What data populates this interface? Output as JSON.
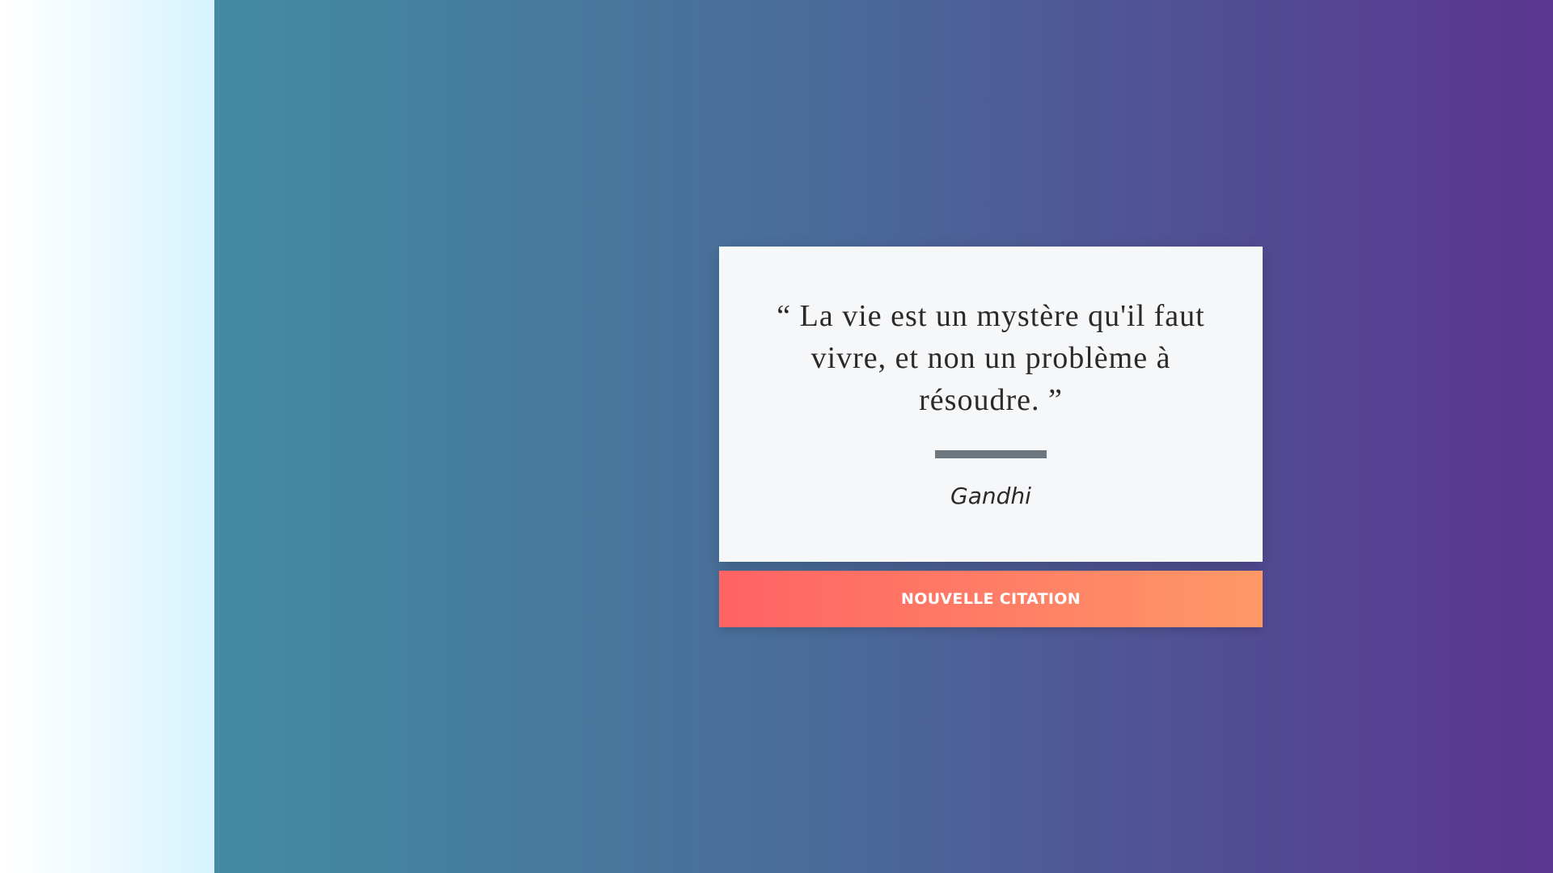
{
  "quote": {
    "open_mark": "“",
    "text": "La vie est un mystère qu'il faut vivre, et non un problème à résoudre.",
    "close_mark": "”",
    "author": "Gandhi"
  },
  "actions": {
    "new_quote_label": "NOUVELLE CITATION"
  },
  "colors": {
    "left_panel": "#d6f3fd",
    "bg_start": "#438ba3",
    "bg_end": "#5b3590",
    "card": "#f6f7f9",
    "divider": "#6c7780",
    "button_start": "#ff6363",
    "button_end": "#ff9966",
    "text": "#2a2a2a"
  }
}
